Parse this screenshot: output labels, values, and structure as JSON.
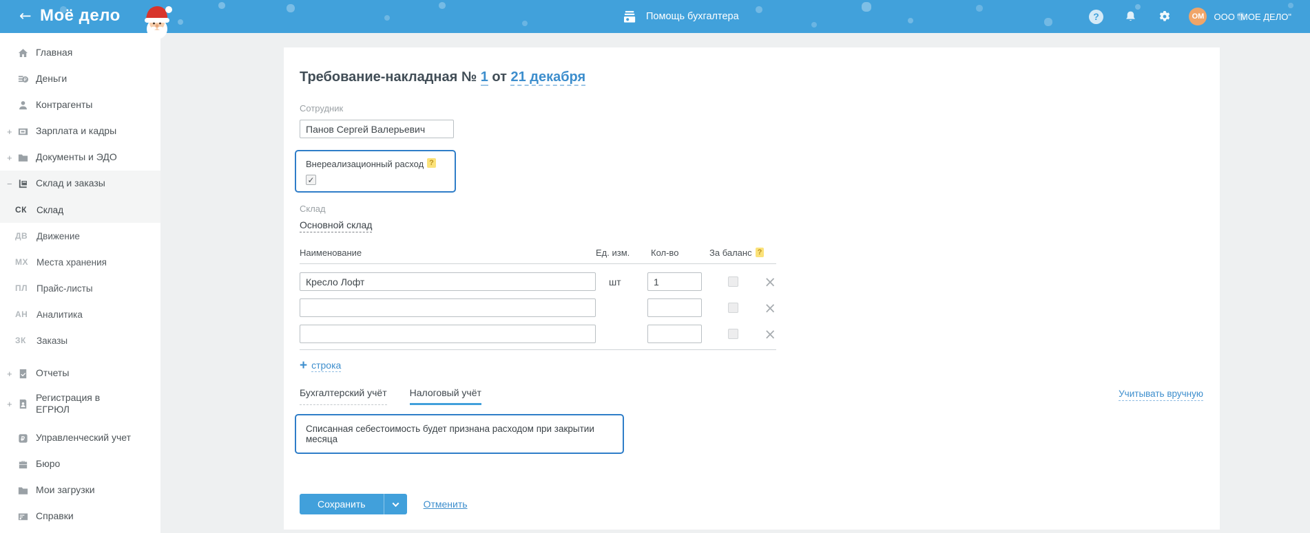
{
  "colors": {
    "header_blue": "#41a1db",
    "accent_blue": "#3d8ecd",
    "focus_border_blue": "#2e7dc8",
    "badge_yellow": "#fbe27a",
    "avatar_orange": "#f0a568"
  },
  "icons": {
    "back": "←",
    "question": "?",
    "check": "✓",
    "delete": "×",
    "plus": "+",
    "minus": "−"
  },
  "header": {
    "logo": "Моё дело",
    "help_center": "Помощь бухгалтера",
    "avatar_initials": "ОМ",
    "account_name": "ООО \"МОЕ ДЕЛО\""
  },
  "sidebar": {
    "items": [
      {
        "label": "Главная"
      },
      {
        "label": "Деньги"
      },
      {
        "label": "Контрагенты"
      },
      {
        "label": "Зарплата и кадры",
        "expander": "+"
      },
      {
        "label": "Документы и ЭДО",
        "expander": "+"
      },
      {
        "label": "Склад и заказы",
        "expander": "−"
      },
      {
        "label": "Отчеты",
        "expander": "+"
      },
      {
        "label": "Регистрация в ЕГРЮЛ",
        "expander": "+"
      },
      {
        "label": "Управленческий учет"
      },
      {
        "label": "Бюро"
      },
      {
        "label": "Мои загрузки"
      },
      {
        "label": "Справки"
      }
    ],
    "sub_items": [
      {
        "code": "СК",
        "label": "Склад"
      },
      {
        "code": "ДВ",
        "label": "Движение"
      },
      {
        "code": "МХ",
        "label": "Места хранения"
      },
      {
        "code": "ПЛ",
        "label": "Прайс-листы"
      },
      {
        "code": "АН",
        "label": "Аналитика"
      },
      {
        "code": "ЗК",
        "label": "Заказы"
      }
    ]
  },
  "form": {
    "title_prefix": "Требование-накладная №",
    "number": "1",
    "conjunction": "от",
    "date": "21 декабря",
    "employee_label": "Сотрудник",
    "employee_value": "Панов Сергей Валерьевич",
    "nonop_expense_label": "Внереализационный расход",
    "warehouse_label": "Склад",
    "warehouse_value": "Основной склад",
    "table": {
      "headers": {
        "name": "Наименование",
        "unit": "Ед. изм.",
        "qty": "Кол-во",
        "balance": "За баланс"
      },
      "rows": [
        {
          "name": "Кресло Лофт",
          "unit": "шт",
          "qty": "1"
        },
        {
          "name": "",
          "unit": "",
          "qty": ""
        },
        {
          "name": "",
          "unit": "",
          "qty": ""
        }
      ]
    },
    "add_row_label": "строка",
    "tabs": [
      {
        "label": "Бухгалтерский учёт"
      },
      {
        "label": "Налоговый учёт"
      }
    ],
    "manual_link": "Учитывать вручную",
    "info_message": "Списанная себестоимость будет признана расходом при закрытии месяца",
    "save_label": "Сохранить",
    "cancel_label": "Отменить"
  }
}
